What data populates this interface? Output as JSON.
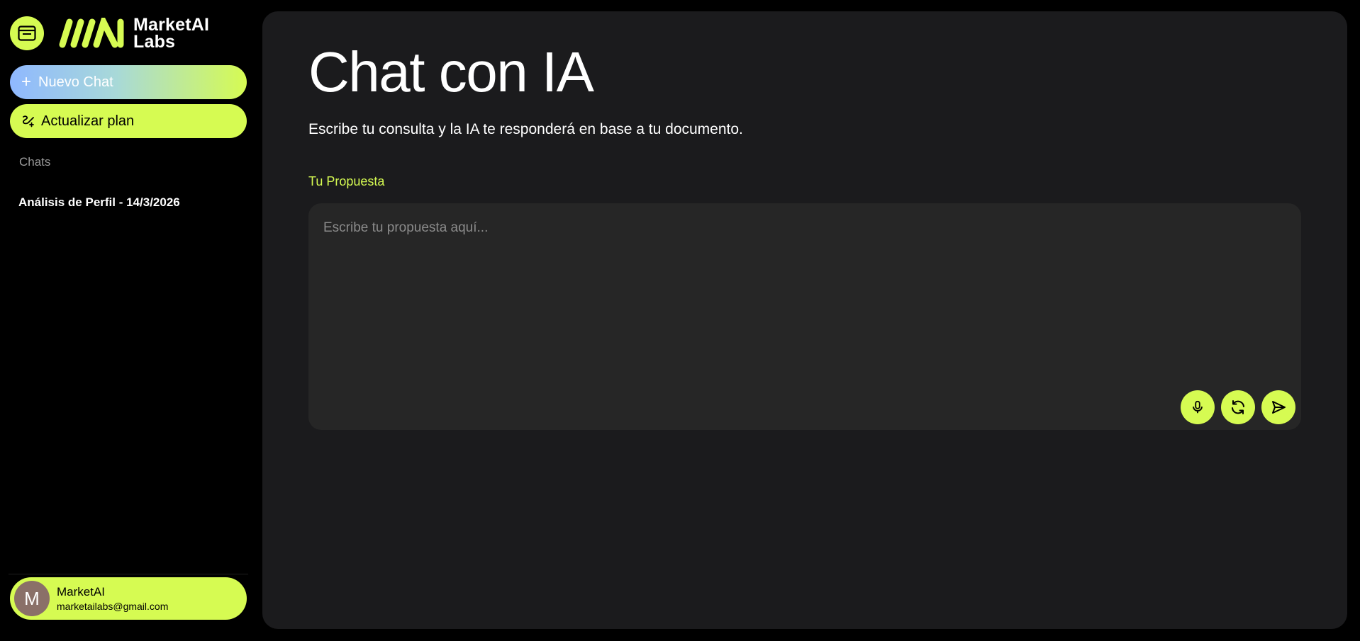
{
  "brand": {
    "name_line1": "MarketAI",
    "name_line2": "Labs",
    "accent_color": "#d6fb52"
  },
  "sidebar": {
    "toggle_icon": "sidebar-window-icon",
    "new_chat_label": "Nuevo Chat",
    "upgrade_label": "Actualizar plan",
    "chats_heading": "Chats",
    "chats": [
      {
        "title": "Análisis de Perfil - 14/3/2026"
      }
    ],
    "user": {
      "initial": "M",
      "name": "MarketAI",
      "email": "marketailabs@gmail.com"
    }
  },
  "main": {
    "title": "Chat con IA",
    "subtitle": "Escribe tu consulta y la IA te responderá en base a tu documento.",
    "field_label": "Tu Propuesta",
    "placeholder": "Escribe tu propuesta aquí...",
    "actions": [
      "microphone-icon",
      "refresh-icon",
      "send-icon"
    ]
  }
}
